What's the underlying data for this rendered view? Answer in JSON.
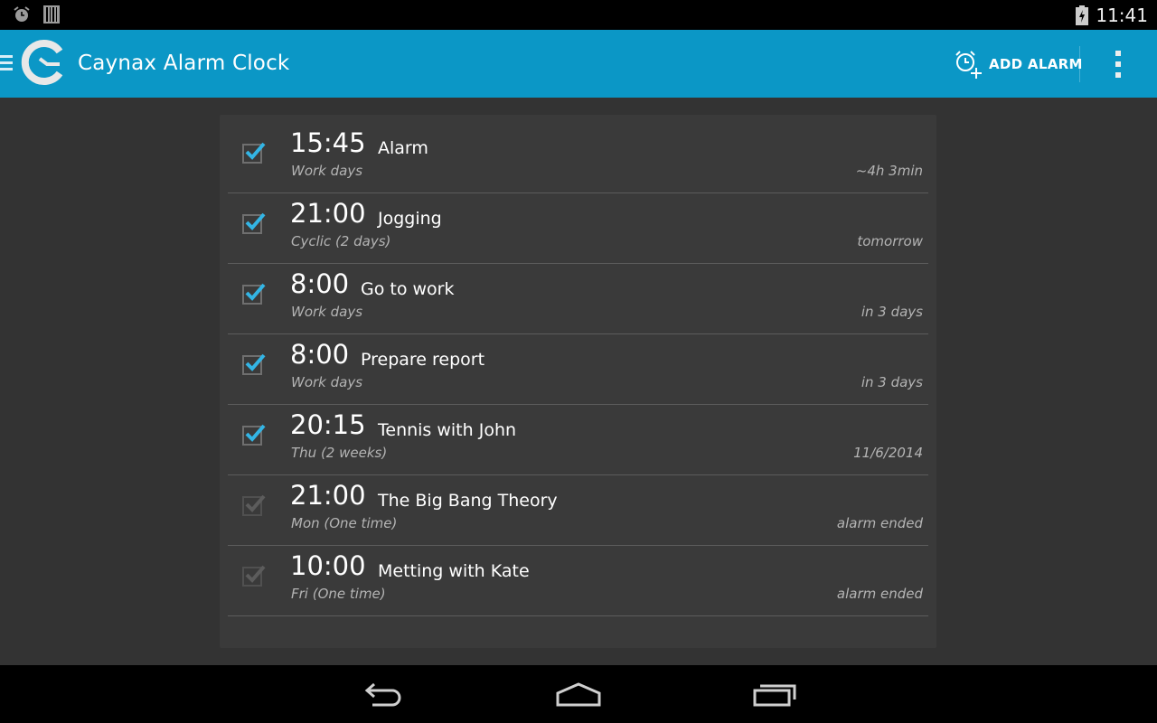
{
  "status_bar": {
    "time": "11:41",
    "icons": [
      "alarm-icon",
      "barcode-icon",
      "battery-icon"
    ]
  },
  "action_bar": {
    "title": "Caynax Alarm Clock",
    "add_alarm_label": "ADD ALARM",
    "accent_color": "#0b97c6"
  },
  "alarms": [
    {
      "time": "15:45",
      "name": "Alarm",
      "repeat": "Work days",
      "when": "~4h 3min",
      "enabled": true
    },
    {
      "time": "21:00",
      "name": "Jogging",
      "repeat": "Cyclic (2 days)",
      "when": "tomorrow",
      "enabled": true
    },
    {
      "time": "8:00",
      "name": "Go to work",
      "repeat": "Work days",
      "when": "in 3 days",
      "enabled": true
    },
    {
      "time": "8:00",
      "name": "Prepare report",
      "repeat": "Work days",
      "when": "in 3 days",
      "enabled": true
    },
    {
      "time": "20:15",
      "name": "Tennis with John",
      "repeat": "Thu (2 weeks)",
      "when": "11/6/2014",
      "enabled": true
    },
    {
      "time": "21:00",
      "name": "The Big Bang Theory",
      "repeat": "Mon (One time)",
      "when": "alarm ended",
      "enabled": false
    },
    {
      "time": "10:00",
      "name": "Metting with Kate",
      "repeat": "Fri (One time)",
      "when": "alarm ended",
      "enabled": false
    }
  ],
  "nav_bar": {
    "buttons": [
      "back-icon",
      "home-icon",
      "recent-apps-icon"
    ]
  }
}
